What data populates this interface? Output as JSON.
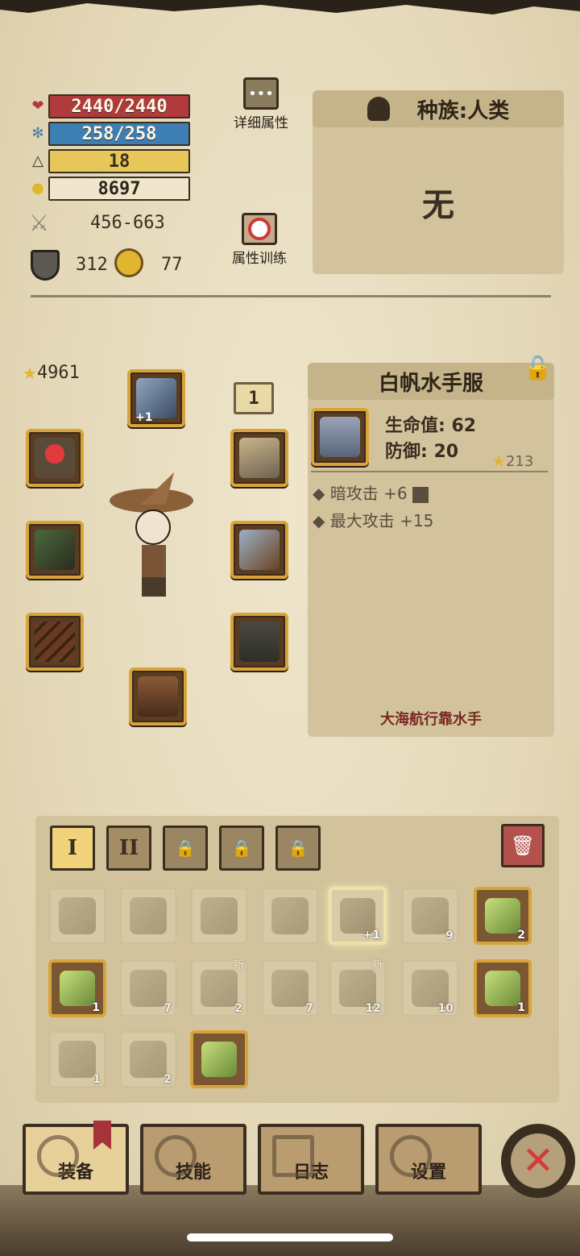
{
  "stats": {
    "hp": "2440/2440",
    "mp": "258/258",
    "level": "18",
    "gold": "8697",
    "attack": "456-663",
    "defense": "312",
    "attack_speed": "77"
  },
  "buttons": {
    "detail_attributes": "详细属性",
    "attribute_training": "属性训练"
  },
  "race_panel": {
    "title": "种族:人类",
    "value": "无"
  },
  "equipment": {
    "power_score": "4961",
    "level_badge": "1",
    "helmet_plus": "+1",
    "slots": [
      "helmet-slot",
      "amulet-slot",
      "ring-slot",
      "necklace-slot",
      "weapon-slot",
      "armor-slot",
      "bracer-slot",
      "pants-slot",
      "boots-slot"
    ]
  },
  "item_panel": {
    "name": "白帆水手服",
    "hp_stat": "生命值: 62",
    "def_stat": "防御: 20",
    "score": "213",
    "affixes": [
      "暗攻击 +6",
      "最大攻击 +15"
    ],
    "flavor": "大海航行靠水手"
  },
  "inventory": {
    "tabs": [
      "I",
      "II",
      "🔒",
      "🔒",
      "🔒"
    ],
    "rows": [
      [
        {
          "c": ""
        },
        {
          "c": ""
        },
        {
          "c": ""
        },
        {
          "c": ""
        },
        {
          "c": "+1",
          "sel": true
        },
        {
          "c": "9"
        },
        {
          "c": "2",
          "bright": true
        }
      ],
      [
        {
          "c": "1",
          "bright": true
        },
        {
          "c": "7"
        },
        {
          "c": "2",
          "new": "新"
        },
        {
          "c": "7"
        },
        {
          "c": "12",
          "new": "新"
        },
        {
          "c": "10"
        },
        {
          "c": "1",
          "bright": true
        }
      ],
      [
        {
          "c": "1"
        },
        {
          "c": "2"
        },
        {
          "c": "",
          "bright": true
        }
      ]
    ]
  },
  "nav": {
    "equip": "装备",
    "skills": "技能",
    "log": "日志",
    "settings": "设置"
  },
  "colors": {
    "hp": "#b03a3c",
    "mp": "#3e7fb3",
    "level": "#e7c65a",
    "slot_border": "#d8a43a",
    "close": "#d63a38"
  }
}
